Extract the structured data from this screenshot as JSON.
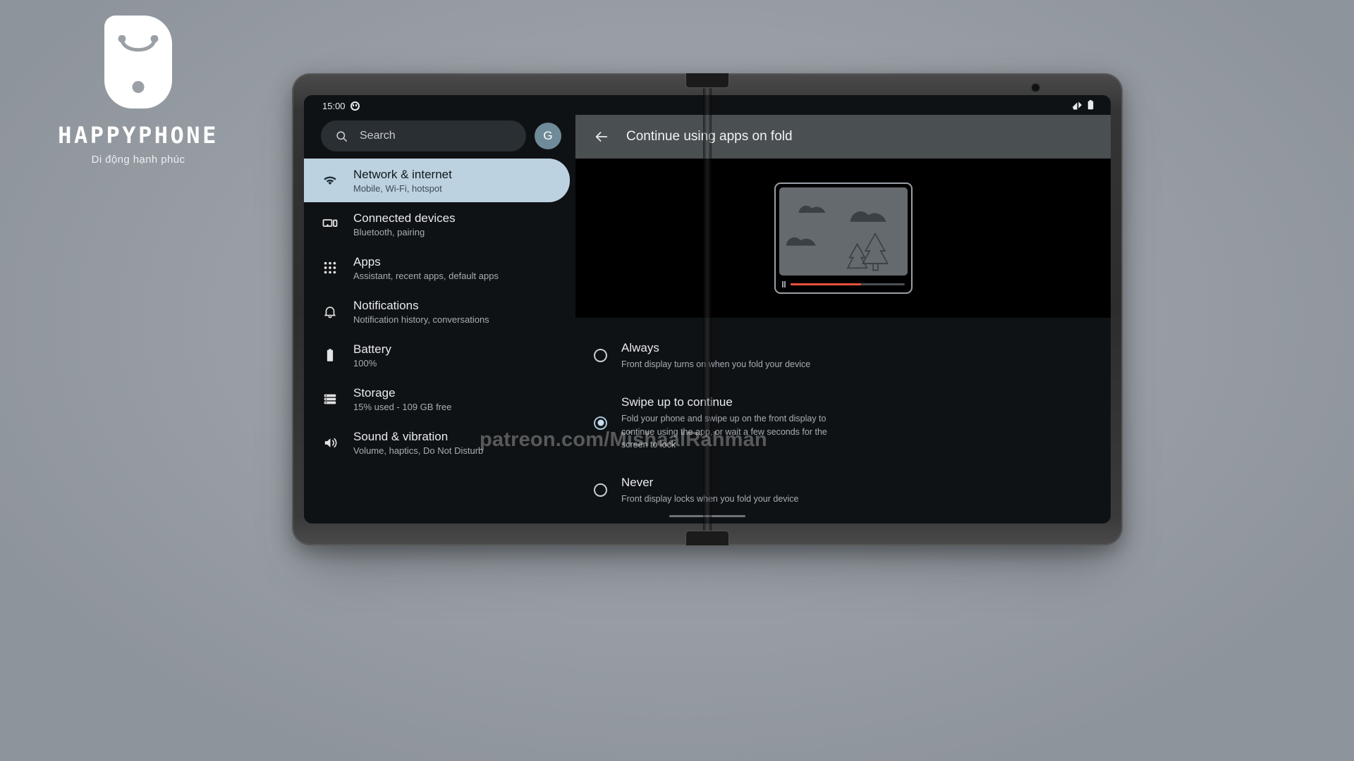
{
  "brand": {
    "name": "HAPPYPHONE",
    "tagline": "Di động hạnh phúc",
    "logo_icon": "shopping-bag-phone-icon",
    "logo_color": "#ffffff"
  },
  "watermark": {
    "text": "patreon.com/MishaalRahman"
  },
  "left_pane": {
    "status_bar": {
      "time": "15:00",
      "icon": "smiley-face-icon"
    },
    "search": {
      "placeholder": "Search",
      "icon": "search-icon"
    },
    "avatar": {
      "initial": "G",
      "color": "#6f8b99"
    },
    "selected_index": 0,
    "selected_color": "#bdd2e0",
    "items": [
      {
        "title": "Network & internet",
        "sub": "Mobile, Wi-Fi, hotspot",
        "icon": "wifi-icon"
      },
      {
        "title": "Connected devices",
        "sub": "Bluetooth, pairing",
        "icon": "connected-devices-icon"
      },
      {
        "title": "Apps",
        "sub": "Assistant, recent apps, default apps",
        "icon": "apps-grid-icon"
      },
      {
        "title": "Notifications",
        "sub": "Notification history, conversations",
        "icon": "bell-icon"
      },
      {
        "title": "Battery",
        "sub": "100%",
        "icon": "battery-icon"
      },
      {
        "title": "Storage",
        "sub": "15% used - 109 GB free",
        "icon": "storage-icon"
      },
      {
        "title": "Sound & vibration",
        "sub": "Volume, haptics, Do Not Disturb",
        "icon": "volume-icon"
      }
    ]
  },
  "right_pane": {
    "status_bar": {
      "signal_icon": "signal-icon",
      "battery_icon": "battery-status-icon"
    },
    "app_bar": {
      "title": "Continue using apps on fold",
      "back_icon": "back-arrow-icon",
      "background": "#4a4f52"
    },
    "illustration": {
      "name": "folded-phone-video-illustration",
      "progress_percent": 62,
      "progress_color": "#e8523f",
      "pause_icon": "pause-icon"
    },
    "options": [
      {
        "title": "Always",
        "desc": "Front display turns on when you fold your device",
        "selected": false
      },
      {
        "title": "Swipe up to continue",
        "desc": "Fold your phone and swipe up on the front display to continue using the app, or wait a few seconds for the screen to lock",
        "selected": true
      },
      {
        "title": "Never",
        "desc": "Front display locks when you fold your device",
        "selected": false
      }
    ]
  }
}
